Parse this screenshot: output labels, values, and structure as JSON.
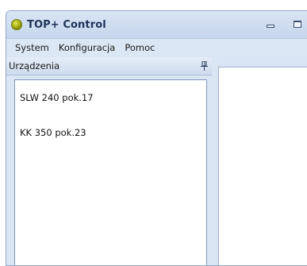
{
  "window": {
    "title": "TOP+ Control"
  },
  "menu": {
    "items": [
      {
        "label": "System"
      },
      {
        "label": "Konfiguracja"
      },
      {
        "label": "Pomoc"
      }
    ]
  },
  "devices_panel": {
    "title": "Urządzenia",
    "items": [
      {
        "label": "SLW 240 pok.17"
      },
      {
        "label": "KK 350 pok.23"
      }
    ]
  },
  "icons": {
    "app": "app-icon",
    "minimize": "minimize-icon",
    "maximize": "maximize-icon",
    "pin": "pin-icon"
  },
  "colors": {
    "titlebar": "#c6d6ec",
    "title_text": "#1e3358",
    "panel_background": "#dbe6f4",
    "list_background": "#ffffff"
  }
}
